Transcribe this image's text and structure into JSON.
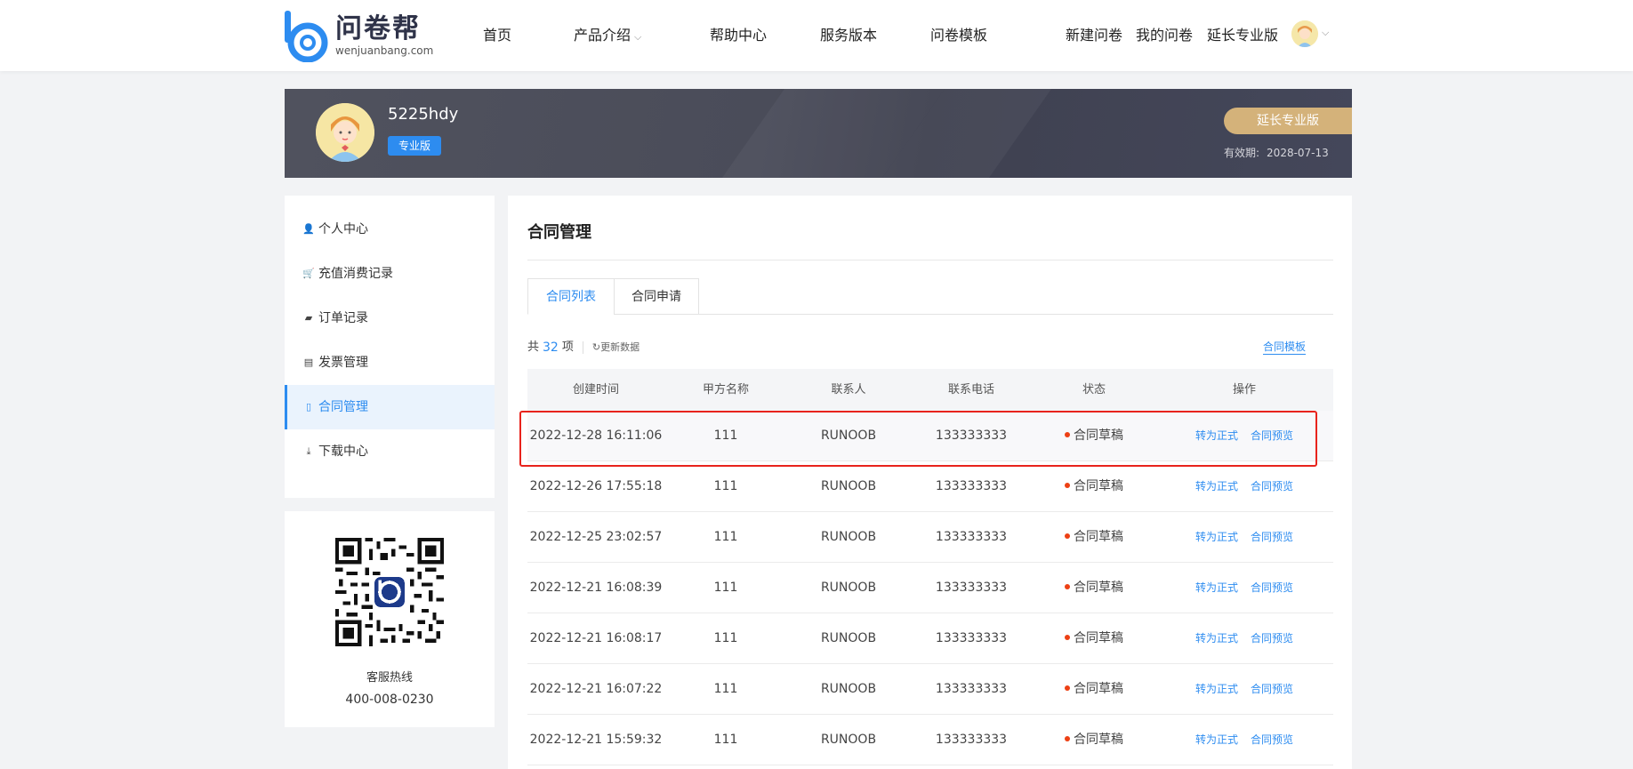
{
  "brand": {
    "name_cn": "问卷帮",
    "domain_text": "wenjuanbang.com",
    "color": "#2d8cf0"
  },
  "nav": {
    "items": [
      "首页",
      "产品介绍",
      "帮助中心",
      "服务版本",
      "问卷模板"
    ],
    "right": [
      "新建问卷",
      "我的问卷",
      "延长专业版"
    ]
  },
  "banner": {
    "username": "5225hdy",
    "badge": "专业版",
    "extend_button": "延长专业版",
    "validity_label": "有效期:",
    "validity_date": "2028-07-13"
  },
  "sidebar": {
    "items": [
      {
        "label": "个人中心",
        "icon": "user-icon"
      },
      {
        "label": "充值消费记录",
        "icon": "cart-icon"
      },
      {
        "label": "订单记录",
        "icon": "ticket-icon"
      },
      {
        "label": "发票管理",
        "icon": "invoice-icon"
      },
      {
        "label": "合同管理",
        "icon": "document-icon",
        "active": true
      },
      {
        "label": "下载中心",
        "icon": "download-icon"
      }
    ]
  },
  "service": {
    "title": "客服热线",
    "phone": "400-008-0230"
  },
  "main": {
    "title": "合同管理",
    "tabs": [
      "合同列表",
      "合同申请"
    ],
    "total_prefix": "共",
    "total": "32",
    "total_suffix": "项",
    "refresh": "更新数据",
    "template_link": "合同模板",
    "columns": [
      "创建时间",
      "甲方名称",
      "联系人",
      "联系电话",
      "状态",
      "操作"
    ],
    "status_color": "#ed4014",
    "rows": [
      {
        "time": "2022-12-28 16:11:06",
        "party": "111",
        "contact": "RUNOOB",
        "phone": "133333333",
        "status": "合同草稿",
        "op1": "转为正式",
        "op2": "合同预览"
      },
      {
        "time": "2022-12-26 17:55:18",
        "party": "111",
        "contact": "RUNOOB",
        "phone": "133333333",
        "status": "合同草稿",
        "op1": "转为正式",
        "op2": "合同预览"
      },
      {
        "time": "2022-12-25 23:02:57",
        "party": "111",
        "contact": "RUNOOB",
        "phone": "133333333",
        "status": "合同草稿",
        "op1": "转为正式",
        "op2": "合同预览"
      },
      {
        "time": "2022-12-21 16:08:39",
        "party": "111",
        "contact": "RUNOOB",
        "phone": "133333333",
        "status": "合同草稿",
        "op1": "转为正式",
        "op2": "合同预览"
      },
      {
        "time": "2022-12-21 16:08:17",
        "party": "111",
        "contact": "RUNOOB",
        "phone": "133333333",
        "status": "合同草稿",
        "op1": "转为正式",
        "op2": "合同预览"
      },
      {
        "time": "2022-12-21 16:07:22",
        "party": "111",
        "contact": "RUNOOB",
        "phone": "133333333",
        "status": "合同草稿",
        "op1": "转为正式",
        "op2": "合同预览"
      },
      {
        "time": "2022-12-21 15:59:32",
        "party": "111",
        "contact": "RUNOOB",
        "phone": "133333333",
        "status": "合同草稿",
        "op1": "转为正式",
        "op2": "合同预览"
      }
    ]
  }
}
